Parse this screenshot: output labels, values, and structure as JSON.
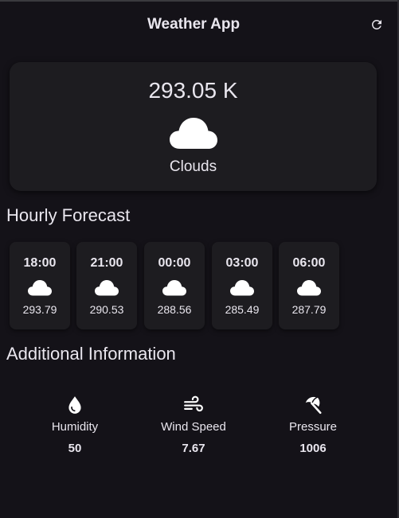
{
  "app": {
    "title": "Weather App",
    "refresh_icon": "refresh-icon"
  },
  "current": {
    "temperature": "293.05 K",
    "condition": "Clouds",
    "icon": "cloud-icon"
  },
  "hourly": {
    "title": "Hourly Forecast",
    "items": [
      {
        "time": "18:00",
        "temp": "293.79",
        "icon": "cloud-icon"
      },
      {
        "time": "21:00",
        "temp": "290.53",
        "icon": "cloud-icon"
      },
      {
        "time": "00:00",
        "temp": "288.56",
        "icon": "cloud-icon"
      },
      {
        "time": "03:00",
        "temp": "285.49",
        "icon": "cloud-icon"
      },
      {
        "time": "06:00",
        "temp": "287.79",
        "icon": "cloud-icon"
      }
    ]
  },
  "additional": {
    "title": "Additional Information",
    "items": [
      {
        "label": "Humidity",
        "value": "50",
        "icon": "water-drop-icon"
      },
      {
        "label": "Wind Speed",
        "value": "7.67",
        "icon": "wind-icon"
      },
      {
        "label": "Pressure",
        "value": "1006",
        "icon": "beach-umbrella-icon"
      }
    ]
  },
  "colors": {
    "background": "#141218",
    "card": "#1d1c20",
    "text": "#e9e6ee"
  }
}
